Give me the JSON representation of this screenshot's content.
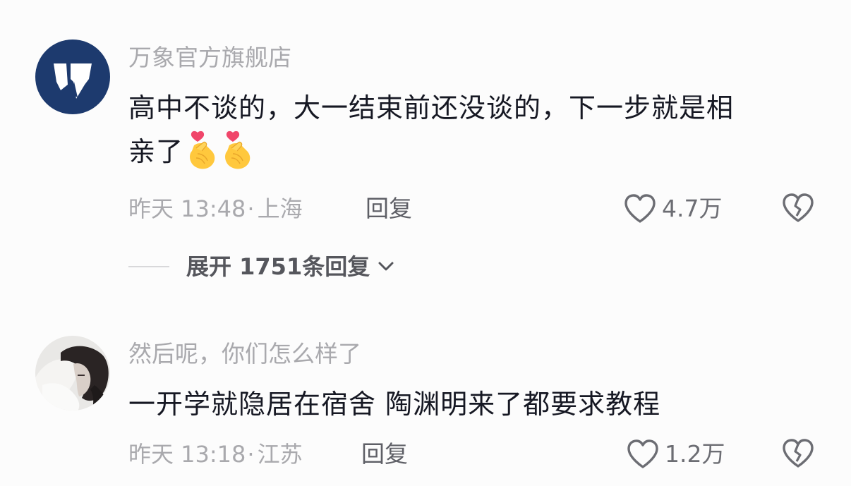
{
  "comments": [
    {
      "username": "万象官方旗舰店",
      "text_line1": "高中不谈的，大一结束前还没谈的，下一步就是相",
      "text_line2": "亲了",
      "emoji": [
        "finger-heart-icon",
        "finger-heart-icon"
      ],
      "time": "昨天 13:48",
      "location": "上海",
      "reply_label": "回复",
      "likes": "4.7万",
      "avatar_color": "#1d3a6e"
    },
    {
      "username": "然后呢，你们怎么样了",
      "text_line1": "一开学就隐居在宿舍 陶渊明来了都要求教程",
      "time": "昨天 13:18",
      "location": "江苏",
      "reply_label": "回复",
      "likes": "1.2万"
    }
  ],
  "expand_replies": {
    "label": "展开 1751条回复"
  },
  "separator": "·",
  "colors": {
    "background": "#fcfcfc",
    "text_primary": "#161823",
    "text_secondary": "#a9a9ad",
    "action_text": "#5e5f66"
  }
}
